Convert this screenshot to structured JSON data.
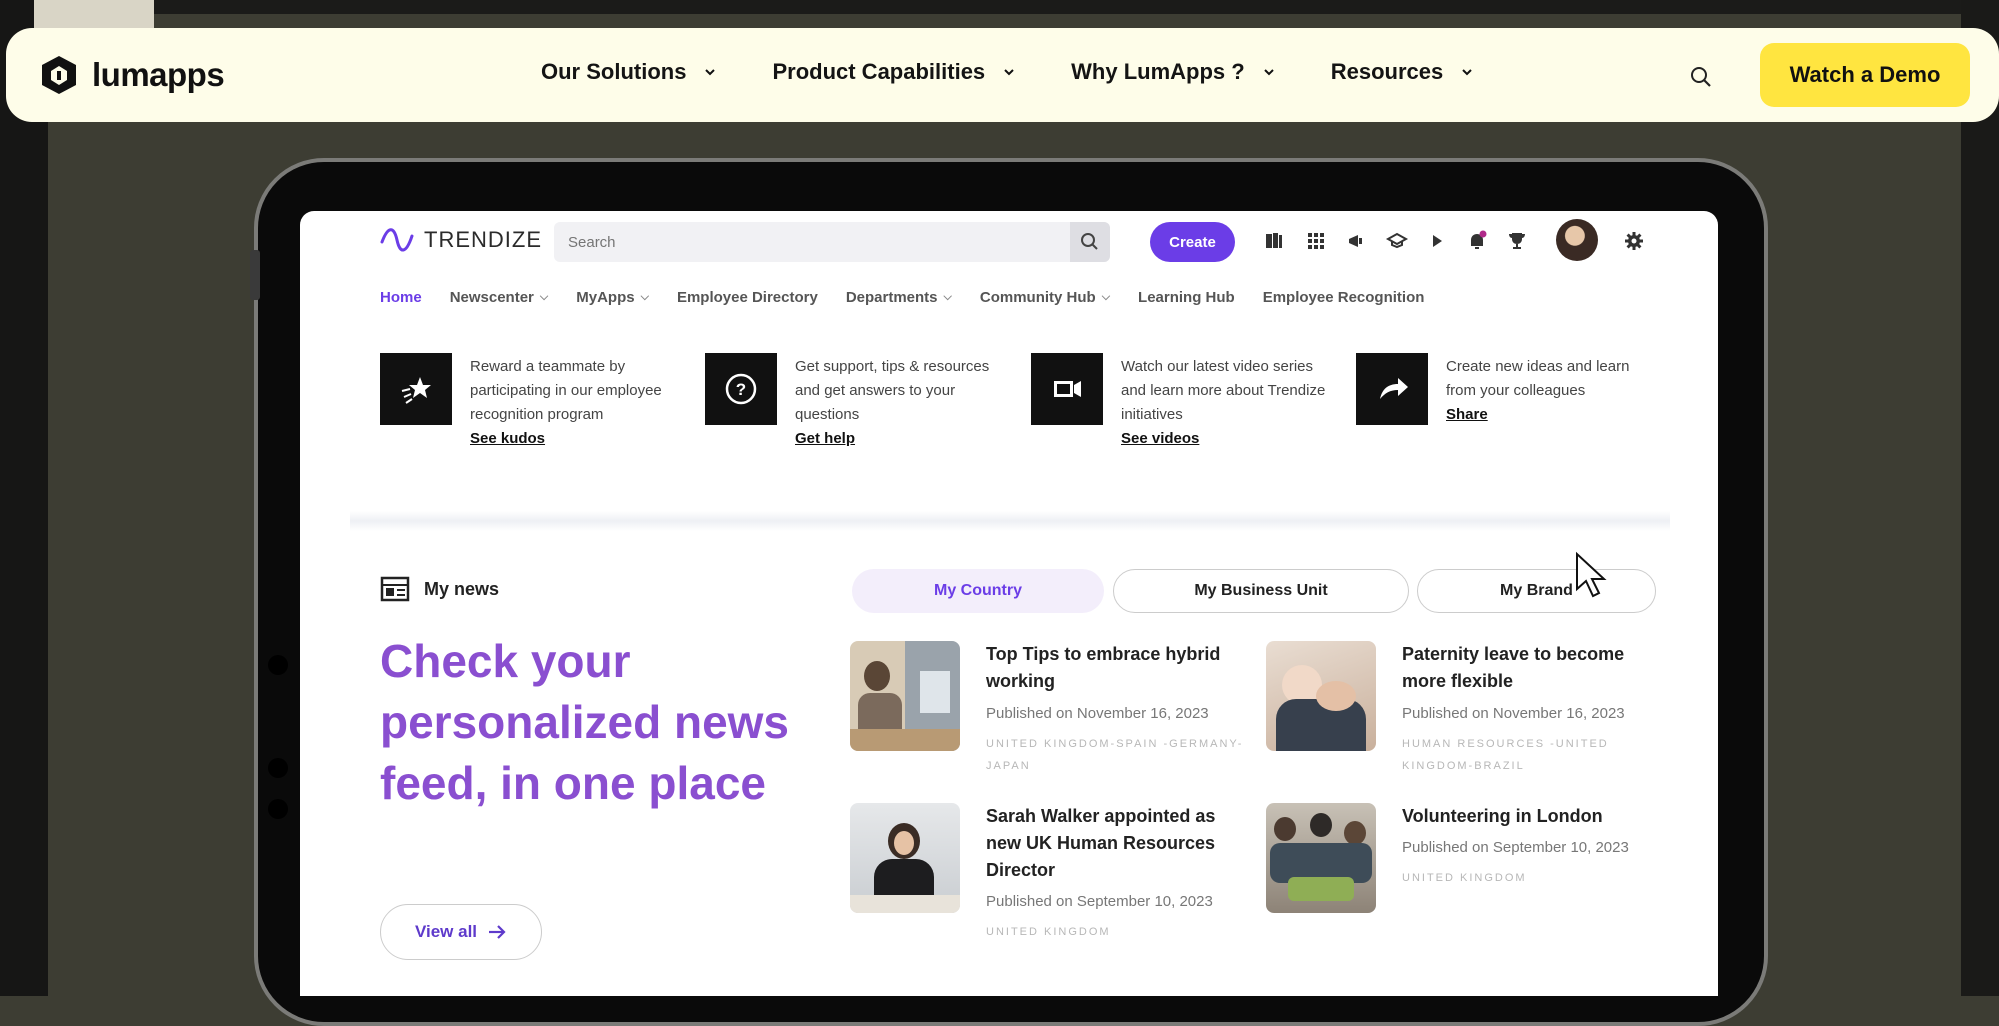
{
  "topnav": {
    "logo": "lumapps",
    "menu": [
      {
        "label": "Our Solutions"
      },
      {
        "label": "Product Capabilities"
      },
      {
        "label": "Why LumApps ?"
      },
      {
        "label": "Resources"
      }
    ],
    "cta": "Watch a Demo"
  },
  "app": {
    "brand": "TRENDIZE",
    "search_placeholder": "Search",
    "create_label": "Create",
    "header_icons": [
      "book-icon",
      "apps-grid-icon",
      "megaphone-icon",
      "school-icon",
      "play-icon",
      "bell-icon",
      "trophy-icon",
      "settings-icon"
    ],
    "nav": [
      {
        "label": "Home",
        "active": true,
        "dropdown": false
      },
      {
        "label": "Newscenter",
        "dropdown": true
      },
      {
        "label": "MyApps",
        "dropdown": true
      },
      {
        "label": "Employee Directory",
        "dropdown": false
      },
      {
        "label": "Departments",
        "dropdown": true
      },
      {
        "label": "Community Hub",
        "dropdown": true
      },
      {
        "label": "Learning Hub",
        "dropdown": false
      },
      {
        "label": "Employee Recognition",
        "dropdown": false
      }
    ],
    "quick_links": [
      {
        "icon": "star-icon",
        "text": "Reward a teammate by participating in our employee recognition program",
        "link": "See kudos"
      },
      {
        "icon": "help-icon",
        "text": "Get support, tips & resources and get answers to your questions",
        "link": "Get help"
      },
      {
        "icon": "video-icon",
        "text": "Watch our latest video series and learn more about Trendize initiatives",
        "link": "See videos"
      },
      {
        "icon": "share-icon",
        "text": "Create new ideas and learn from your colleagues",
        "link": "Share"
      }
    ],
    "news": {
      "section_title": "My news",
      "headline": "Check your personalized news feed, in one place",
      "view_all": "View all",
      "tabs": [
        "My Country",
        "My Business Unit",
        "My Brand"
      ],
      "active_tab": "My Country",
      "articles": [
        {
          "title": "Top Tips to embrace hybrid working",
          "date": "Published on November 16, 2023",
          "tags": "UNITED KINGDOM-SPAIN -GERMANY-JAPAN"
        },
        {
          "title": "Paternity leave to become more flexible",
          "date": "Published on November 16, 2023",
          "tags": "HUMAN RESOURCES -UNITED KINGDOM-BRAZIL"
        },
        {
          "title": "Sarah Walker appointed as new UK Human Resources Director",
          "date": "Published on September 10, 2023",
          "tags": "UNITED KINGDOM"
        },
        {
          "title": "Volunteering in London",
          "date": "Published on September 10, 2023",
          "tags": "UNITED KINGDOM"
        }
      ]
    }
  },
  "colors": {
    "accent": "#6b3de7",
    "headline": "#8a4fd0",
    "cta": "#ffe540",
    "navbar_bg": "#fefde9"
  }
}
